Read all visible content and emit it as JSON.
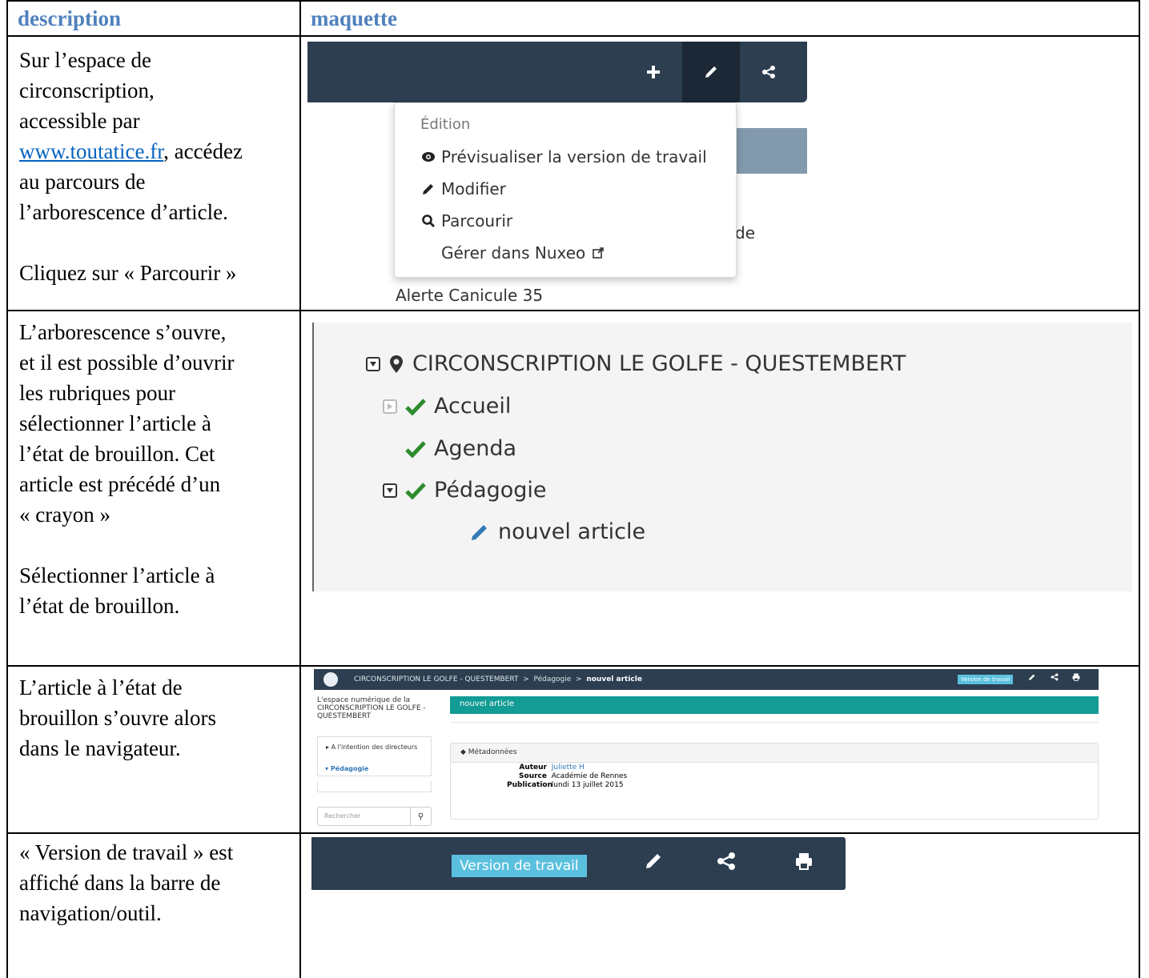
{
  "headers": {
    "description": "description",
    "maquette": "maquette"
  },
  "rows": [
    {
      "lines": [
        "Sur l’espace de",
        "circonscription,",
        "accessible par"
      ],
      "link": "www.toutatice.fr",
      "link_suffix": ", accédez",
      "lines_after": [
        "au parcours de",
        "l’arborescence d’article."
      ],
      "action": "Cliquez sur « Parcourir »"
    },
    {
      "lines": [
        "L’arborescence s’ouvre,",
        "et il est possible d’ouvrir",
        "les rubriques pour",
        "sélectionner l’article à",
        "l’état de brouillon. Cet",
        "article est précédé d’un",
        "« crayon »"
      ],
      "action_lines": [
        "Sélectionner l’article à",
        "l’état de brouillon."
      ]
    },
    {
      "lines": [
        "L’article à l’état de",
        "brouillon s’ouvre alors",
        "dans le navigateur."
      ]
    },
    {
      "lines": [
        "« Version de travail » est",
        "affiché dans la barre de",
        "navigation/outil."
      ]
    }
  ],
  "mockup1": {
    "menu_header": "Édition",
    "items": [
      {
        "icon": "eye-icon",
        "label": "Prévisualiser la version de travail"
      },
      {
        "icon": "pencil-icon",
        "label": "Modifier"
      },
      {
        "icon": "search-icon",
        "label": "Parcourir"
      },
      {
        "icon": "",
        "label": "Gérer dans Nuxeo",
        "suffix_icon": "external-link-icon"
      }
    ],
    "behind_text_right": "de",
    "behind_text_bottom": "Alerte Canicule 35"
  },
  "mockup2": {
    "root": "CIRCONSCRIPTION LE GOLFE - QUESTEMBERT",
    "children": [
      {
        "label": "Accueil",
        "status": "published"
      },
      {
        "label": "Agenda",
        "status": "published"
      },
      {
        "label": "Pédagogie",
        "status": "published"
      },
      {
        "label": "nouvel article",
        "status": "draft"
      }
    ]
  },
  "mockup3": {
    "breadcrumb": [
      "CIRCONSCRIPTION LE GOLFE - QUESTEMBERT",
      ">",
      "Pédagogie",
      ">",
      "nouvel article"
    ],
    "badge": "Version de travail",
    "site_title": "L'espace numérique de la CIRCONSCRIPTION LE GOLFE - QUESTEMBERT",
    "nav": [
      {
        "label": "A l'intention des directeurs",
        "active": false
      },
      {
        "label": "Pédagogie",
        "active": true
      }
    ],
    "search_placeholder": "Rechercher",
    "article_title": "nouvel article",
    "meta_header": "Métadonnées",
    "meta": [
      {
        "key": "Auteur",
        "value": "Juliette H"
      },
      {
        "key": "Source",
        "value": "Académie de Rennes"
      },
      {
        "key": "Publication",
        "value": "lundi 13 juillet 2015"
      }
    ]
  },
  "mockup4": {
    "badge": "Version de travail"
  },
  "colors": {
    "header_blue": "#4f81bd",
    "toolbar": "#2c3e50",
    "badge": "#5bc0de",
    "teal": "#139b95",
    "link": "#0563c1",
    "check_green": "#2e8b2e",
    "pencil_blue": "#337ab7"
  }
}
